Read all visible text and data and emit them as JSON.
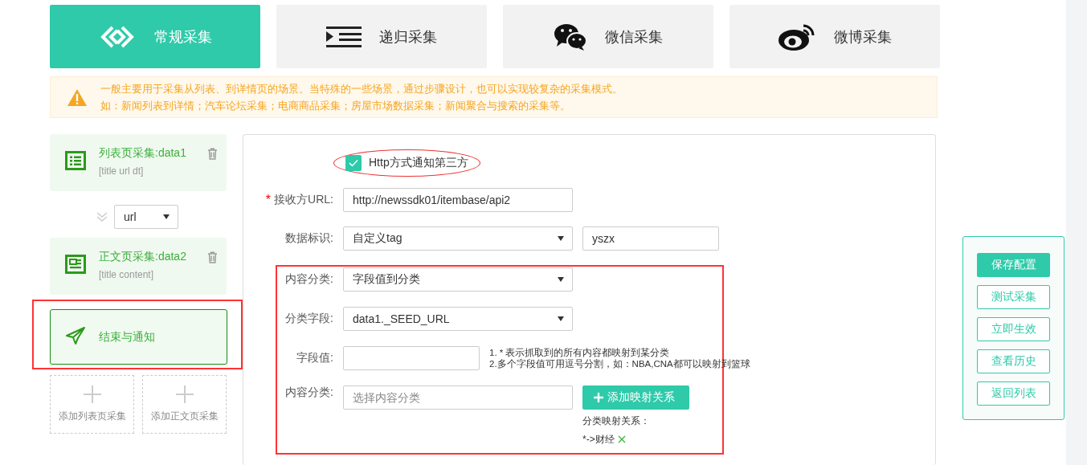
{
  "tabs": [
    {
      "label": "常规采集",
      "kind": "regular",
      "selected": true
    },
    {
      "label": "递归采集",
      "kind": "recursive",
      "selected": false
    },
    {
      "label": "微信采集",
      "kind": "wechat",
      "selected": false
    },
    {
      "label": "微博采集",
      "kind": "weibo",
      "selected": false
    }
  ],
  "alert": {
    "lines": [
      "一般主要用于采集从列表、到详情页的场景。当特殊的一些场景，通过步骤设计，也可以实现较复杂的采集模式。",
      "如：新闻列表到详情；汽车论坛采集；电商商品采集；房屋市场数据采集；新闻聚合与搜索的采集等。"
    ]
  },
  "steps": [
    {
      "kind": "list",
      "title": "列表页采集:data1",
      "fields": "[title url dt]",
      "selected": false,
      "highlighted": false
    },
    {
      "kind": "link",
      "value": "url"
    },
    {
      "kind": "content",
      "title": "正文页采集:data2",
      "fields": "[title content]",
      "selected": false,
      "highlighted": false
    },
    {
      "kind": "finish",
      "title": "结束与通知",
      "selected": true,
      "highlighted": true
    }
  ],
  "add_buttons": [
    "添加列表页采集",
    "添加正文页采集"
  ],
  "form": {
    "notify": {
      "label": "Http方式通知第三方",
      "checked": true,
      "highlighted": true
    },
    "rows": [
      {
        "kind": "input",
        "label": "接收方URL:",
        "required_mark": "*",
        "value": "http://newssdk01/itembase/api2"
      },
      {
        "kind": "select_input",
        "label": "数据标识:",
        "value": "自定义tag",
        "extra": "yszx"
      }
    ],
    "category_section": {
      "highlighted": true,
      "rows": [
        {
          "kind": "select",
          "label": "内容分类:",
          "value": "字段值到分类"
        },
        {
          "kind": "select",
          "label": "分类字段:",
          "value": "data1._SEED_URL"
        },
        {
          "kind": "hint_input",
          "label": "字段值:",
          "hints": [
            "1. * 表示抓取到的所有内容都映射到某分类",
            "2.多个字段值可用逗号分割，如：NBA,CNA都可以映射到篮球"
          ]
        },
        {
          "kind": "mapping",
          "label": "内容分类:",
          "placeholder": "选择内容分类",
          "button": "添加映射关系",
          "mapping_label": "分类映射关系：",
          "mappings": [
            "*->财经"
          ]
        }
      ]
    }
  },
  "toolbar": [
    {
      "label": "保存配置",
      "primary": true
    },
    {
      "label": "测试采集",
      "primary": false
    },
    {
      "label": "立即生效",
      "primary": false
    },
    {
      "label": "查看历史",
      "primary": false
    },
    {
      "label": "返回列表",
      "primary": false
    }
  ]
}
